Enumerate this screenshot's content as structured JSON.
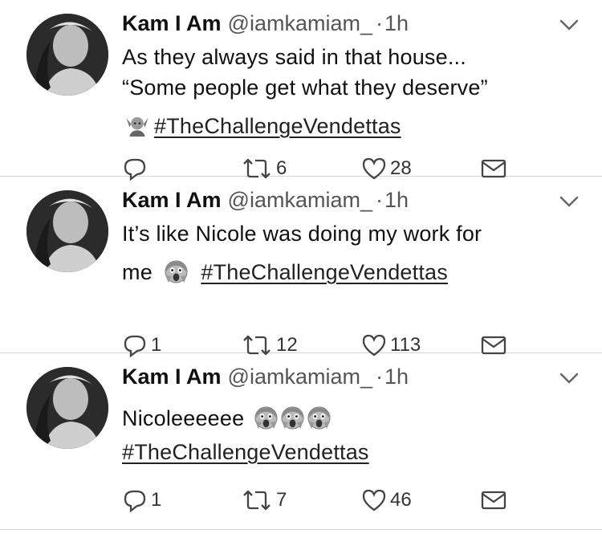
{
  "tweets": [
    {
      "name": "Kam I Am",
      "handle": "@iamkamiam_",
      "dot": "·",
      "time": "1h",
      "lines": [
        "As they always said in that house...",
        "“Some people get what they deserve”"
      ],
      "hashtag_prefix_emoji": "man-gesturing-emoji",
      "hashtag": "#TheChallengeVendettas",
      "replies": "",
      "retweets": "6",
      "likes": "28"
    },
    {
      "name": "Kam I Am",
      "handle": "@iamkamiam_",
      "dot": "·",
      "time": "1h",
      "lines": [
        "It’s like Nicole was doing my work for",
        "me"
      ],
      "hashtag": "#TheChallengeVendettas",
      "replies": "1",
      "retweets": "12",
      "likes": "113"
    },
    {
      "name": "Kam I Am",
      "handle": "@iamkamiam_",
      "dot": "·",
      "time": "1h",
      "lines": [
        "Nicoleeeeee"
      ],
      "hashtag": "#TheChallengeVendettas",
      "replies": "1",
      "retweets": "7",
      "likes": "46"
    }
  ],
  "icons": {
    "reply": "reply-icon",
    "retweet": "retweet-icon",
    "like": "heart-icon",
    "dm": "envelope-icon",
    "more": "chevron-down-icon",
    "crying": "screaming-face-emoji"
  }
}
